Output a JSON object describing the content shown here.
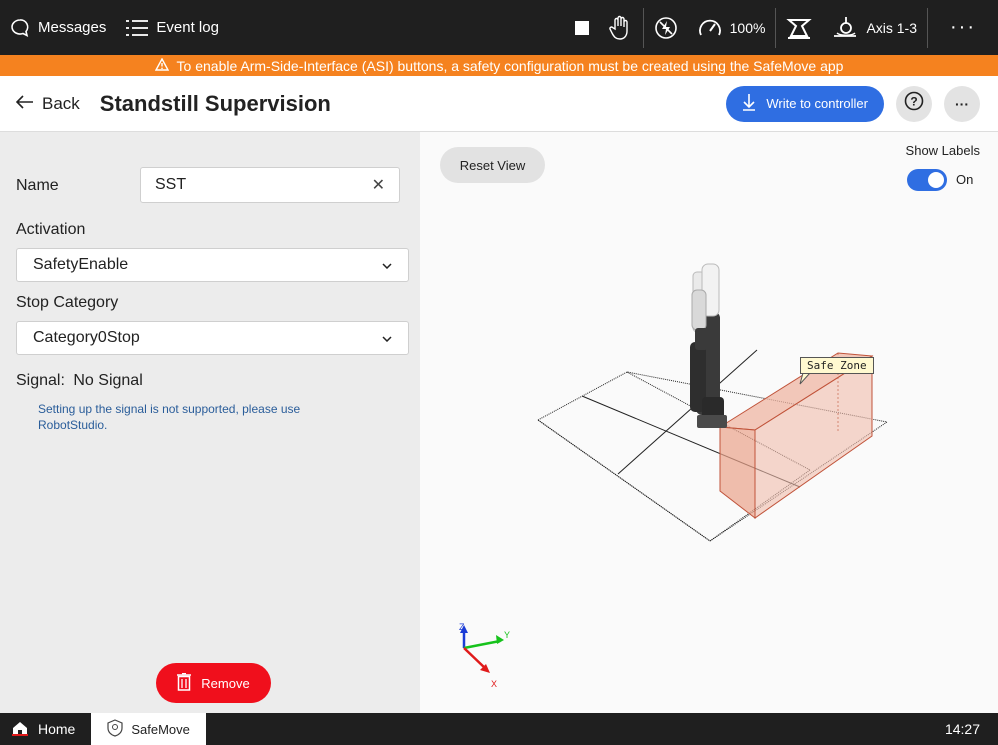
{
  "topbar": {
    "messages_label": "Messages",
    "eventlog_label": "Event log",
    "speed": "100%",
    "axis": "Axis 1-3",
    "more": "···"
  },
  "warning": {
    "text": "To enable Arm-Side-Interface (ASI) buttons, a safety configuration must be created using the SafeMove app"
  },
  "header": {
    "back_label": "Back",
    "title": "Standstill Supervision",
    "write_label": "Write to controller",
    "help": "?",
    "more": "···"
  },
  "form": {
    "name_label": "Name",
    "name_value": "SST",
    "activation_label": "Activation",
    "activation_value": "SafetyEnable",
    "stop_label": "Stop Category",
    "stop_value": "Category0Stop",
    "signal_label": "Signal:",
    "signal_value": "No Signal",
    "info": "Setting up the signal is not supported, please use RobotStudio.",
    "remove_label": "Remove"
  },
  "viewport": {
    "reset_label": "Reset View",
    "show_labels": "Show Labels",
    "toggle_state": "On",
    "zone_label": "Safe Zone",
    "axes": {
      "x": "X",
      "y": "Y",
      "z": "Z"
    }
  },
  "statusbar": {
    "home_label": "Home",
    "app_label": "SafeMove",
    "time": "14:27"
  },
  "colors": {
    "accent": "#2f6ee2",
    "warning": "#f5821f",
    "danger": "#f00f1c",
    "zone": "#e8a08a"
  }
}
